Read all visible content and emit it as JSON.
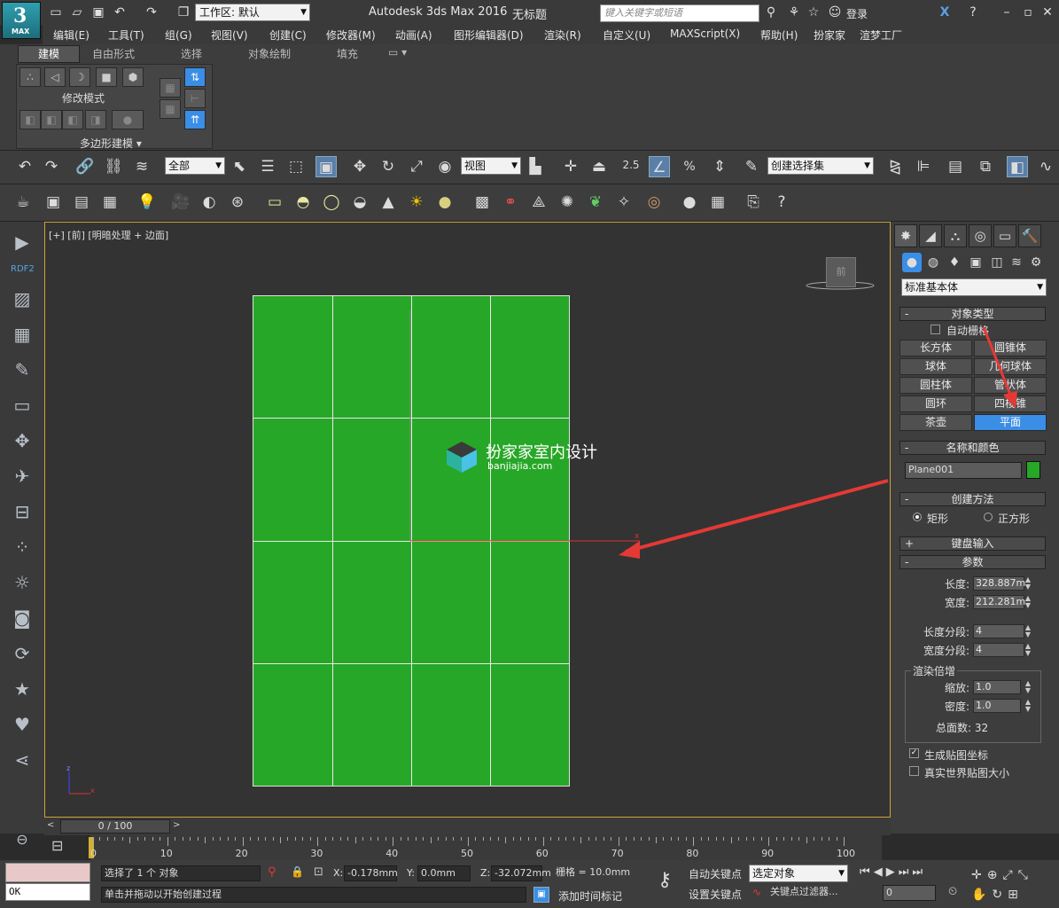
{
  "app": {
    "logo_text": "3",
    "logo_sub": "MAX",
    "title": "Autodesk 3ds Max 2016",
    "document": "无标题",
    "workspace": "工作区: 默认",
    "search_placeholder": "键入关键字或短语",
    "login": "登录"
  },
  "menu": [
    "编辑(E)",
    "工具(T)",
    "组(G)",
    "视图(V)",
    "创建(C)",
    "修改器(M)",
    "动画(A)",
    "图形编辑器(D)",
    "渲染(R)",
    "自定义(U)",
    "MAXScript(X)",
    "帮助(H)",
    "扮家家",
    "渲梦工厂"
  ],
  "ribbon": {
    "tabs": [
      "建模",
      "自由形式",
      "选择",
      "对象绘制",
      "填充"
    ],
    "modify_mode": "修改模式",
    "poly_modeling": "多边形建模"
  },
  "toolbar": {
    "filter": "全部",
    "coord": "视图",
    "snap_value": "2.5",
    "named_selection": "创建选择集"
  },
  "left_bar": {
    "label": "RDF2"
  },
  "viewport": {
    "label": "[+] [前] [明暗处理 + 边面]",
    "watermark_name": "扮家家室内设计",
    "watermark_url": "banjiajia.com",
    "viewcube": "前",
    "plane_color": "#27a727"
  },
  "command_panel": {
    "category": "标准基本体",
    "object_type": {
      "title": "对象类型",
      "autogrid": "自动栅格",
      "buttons": [
        "长方体",
        "圆锥体",
        "球体",
        "几何球体",
        "圆柱体",
        "管状体",
        "圆环",
        "四棱锥",
        "茶壶",
        "平面"
      ],
      "selected": "平面"
    },
    "name_color": {
      "title": "名称和颜色",
      "name": "Plane001",
      "color": "#27a727"
    },
    "creation_method": {
      "title": "创建方法",
      "options": [
        "矩形",
        "正方形"
      ],
      "selected": "矩形"
    },
    "keyboard_entry": "键盘输入",
    "parameters": {
      "title": "参数",
      "length_label": "长度:",
      "length": "328.887m",
      "width_label": "宽度:",
      "width": "212.281m",
      "length_segs_label": "长度分段:",
      "length_segs": "4",
      "width_segs_label": "宽度分段:",
      "width_segs": "4",
      "render_mult": "渲染倍增",
      "scale_label": "缩放:",
      "scale": "1.0",
      "density_label": "密度:",
      "density": "1.0",
      "total_faces": "总面数: 32",
      "gen_map": "生成贴图坐标",
      "real_world": "真实世界贴图大小"
    }
  },
  "timeline": {
    "frame": "0 / 100",
    "ticks": [
      "0",
      "10",
      "20",
      "30",
      "40",
      "50",
      "60",
      "70",
      "80",
      "90",
      "100"
    ]
  },
  "status": {
    "selection": "选择了 1 个 对象",
    "prompt": "单击并拖动以开始创建过程",
    "x_label": "X:",
    "x": "-0.178mm",
    "y_label": "Y:",
    "y": "0.0mm",
    "z_label": "Z:",
    "z": "-32.072mm",
    "grid": "栅格 = 10.0mm",
    "auto_key": "自动关键点",
    "set_key": "设置关键点",
    "selected_object": "选定对象",
    "key_filters": "关键点过滤器...",
    "add_time_tag": "添加时间标记",
    "frame_field": "0",
    "mini_listener": "OK"
  }
}
